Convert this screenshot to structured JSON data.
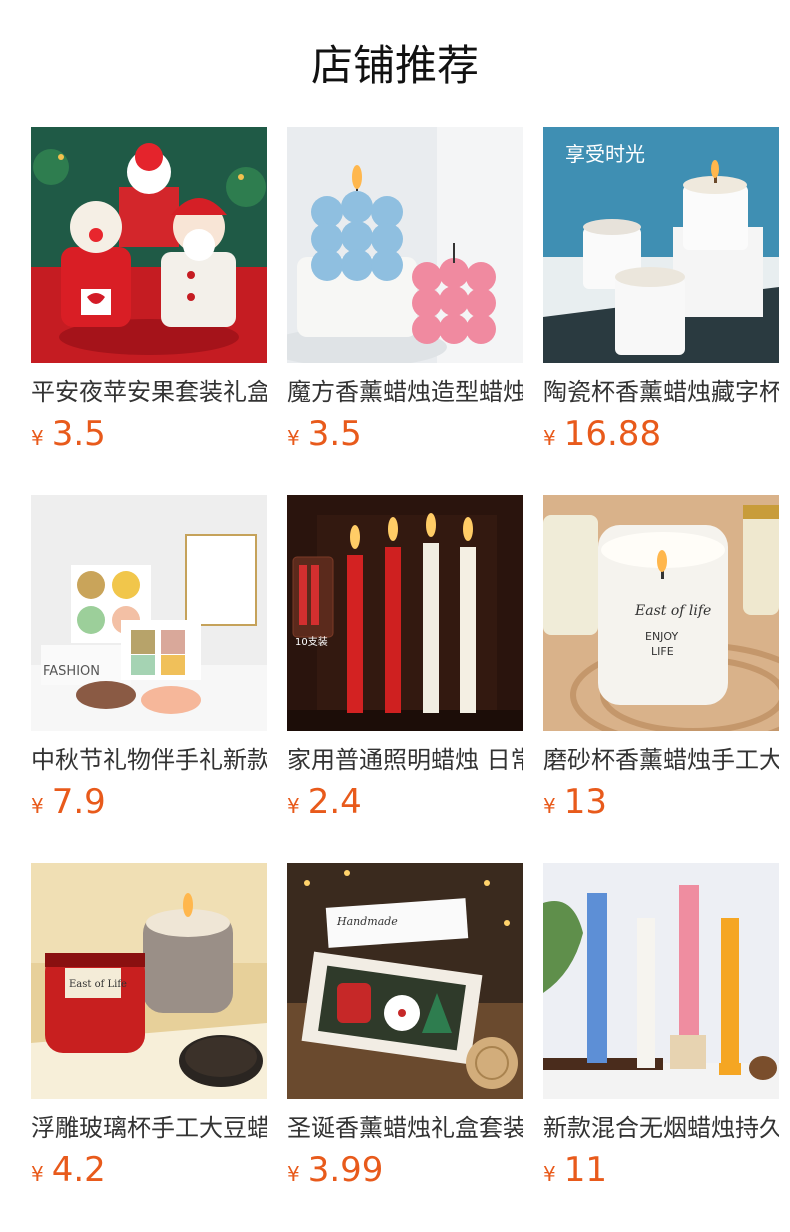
{
  "header": {
    "title": "店铺推荐"
  },
  "currency_symbol": "¥",
  "products": [
    {
      "name": "平安夜苹安果套装礼盒",
      "price": "3.5",
      "icon": "christmas-plush-icon"
    },
    {
      "name": "魔方香薰蜡烛造型蜡烛",
      "price": "3.5",
      "icon": "cube-candle-icon"
    },
    {
      "name": "陶瓷杯香薰蜡烛藏字杯",
      "price": "16.88",
      "icon": "ceramic-candle-icon"
    },
    {
      "name": "中秋节礼物伴手礼新款",
      "price": "7.9",
      "icon": "mooncake-soap-icon"
    },
    {
      "name": "家用普通照明蜡烛 日常",
      "price": "2.4",
      "icon": "taper-candles-icon"
    },
    {
      "name": "磨砂杯香薰蜡烛手工大豆",
      "price": "13",
      "icon": "frosted-jar-candle-icon"
    },
    {
      "name": "浮雕玻璃杯手工大豆蜡烛",
      "price": "4.2",
      "icon": "embossed-glass-candle-icon"
    },
    {
      "name": "圣诞香薰蜡烛礼盒套装",
      "price": "3.99",
      "icon": "christmas-gift-box-icon"
    },
    {
      "name": "新款混合无烟蜡烛持久",
      "price": "11",
      "icon": "pillar-candles-icon"
    }
  ],
  "image_captions": {
    "p2_text": "享受时光",
    "p4_text": "FASHION",
    "p5_text": "10支装",
    "p6_text": "East of life",
    "p6_sub1": "ENJOY",
    "p6_sub2": "LIFE",
    "p7_text": "East of Life",
    "p8_text": "Handmade"
  }
}
